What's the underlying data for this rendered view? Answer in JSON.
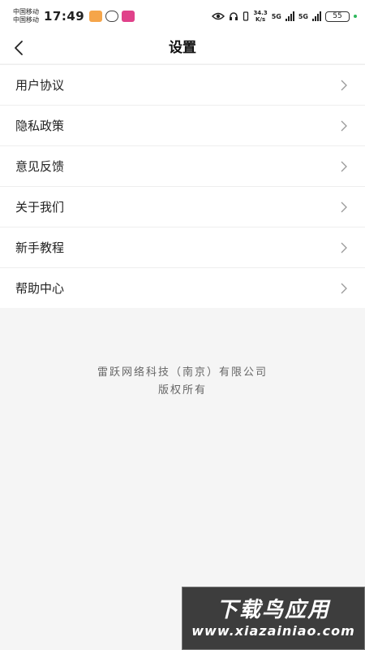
{
  "status_bar": {
    "carrier_1": "中国移动",
    "carrier_2": "中国移动",
    "time": "17:49",
    "speed_value": "34.3",
    "speed_unit": "K/s",
    "net_1": "5G",
    "net_2": "5G",
    "battery": "55",
    "colors": {
      "app1": "#f5a54a",
      "app2": "#444444",
      "app3": "#e0418a",
      "dot": "#2eb85c"
    }
  },
  "nav": {
    "title": "设置",
    "back_icon": "chevron-left-icon"
  },
  "menu": {
    "items": [
      {
        "label": "用户协议"
      },
      {
        "label": "隐私政策"
      },
      {
        "label": "意见反馈"
      },
      {
        "label": "关于我们"
      },
      {
        "label": "新手教程"
      },
      {
        "label": "帮助中心"
      }
    ],
    "chevron_icon": "chevron-right-icon"
  },
  "footer": {
    "company": "雷跃网络科技（南京）有限公司",
    "rights": "版权所有"
  },
  "watermark": {
    "title": "下载鸟应用",
    "url": "www.xiazainiao.com"
  }
}
